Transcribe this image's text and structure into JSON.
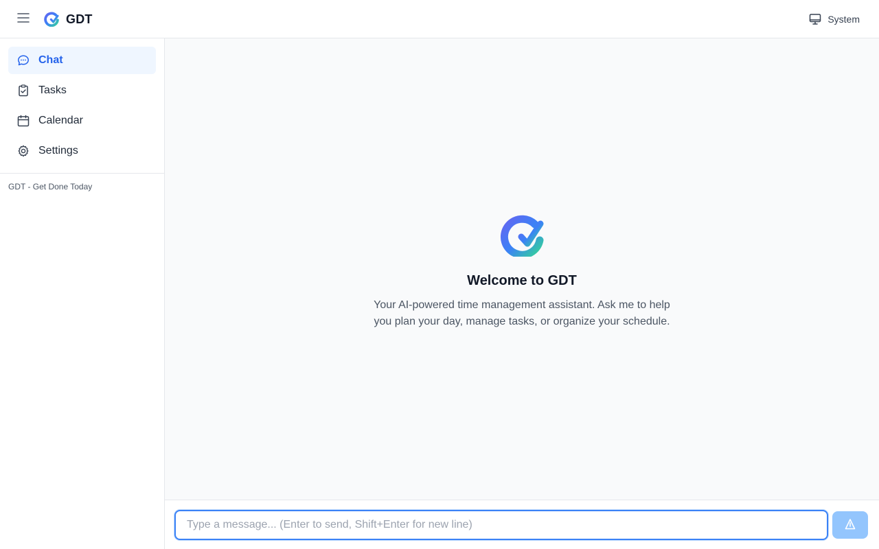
{
  "header": {
    "app_name": "GDT",
    "menu_icon": "hamburger-menu-icon",
    "theme_label": "System",
    "theme_icon": "monitor-icon"
  },
  "sidebar": {
    "items": [
      {
        "label": "Chat",
        "icon": "chat-bubble-icon",
        "active": true
      },
      {
        "label": "Tasks",
        "icon": "clipboard-check-icon",
        "active": false
      },
      {
        "label": "Calendar",
        "icon": "calendar-icon",
        "active": false
      },
      {
        "label": "Settings",
        "icon": "gear-icon",
        "active": false
      }
    ],
    "footer": "GDT - Get Done Today"
  },
  "main": {
    "welcome_title": "Welcome to GDT",
    "welcome_text": "Your AI-powered time management assistant. Ask me to help you plan your day, manage tasks, or organize your schedule."
  },
  "composer": {
    "placeholder": "Type a message... (Enter to send, Shift+Enter for new line)",
    "value": "",
    "send_icon": "send-icon"
  },
  "colors": {
    "accent": "#2563eb",
    "active_bg": "#eff6ff",
    "send_button": "#93c5fd",
    "logo_gradient": [
      "#6366f1",
      "#3b82f6",
      "#34d399"
    ]
  }
}
